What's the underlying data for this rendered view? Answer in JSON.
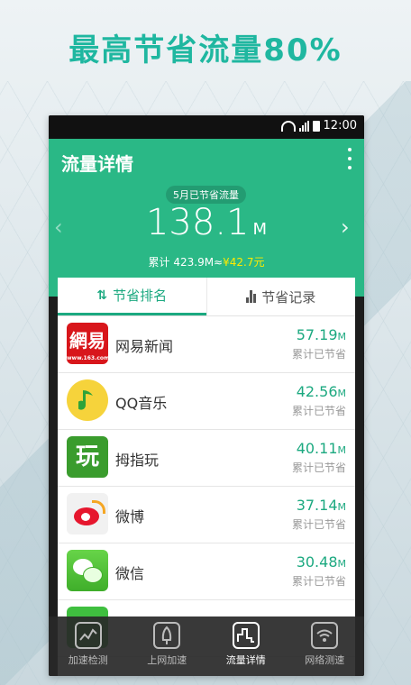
{
  "headline": "最高节省流量80%",
  "status_bar": {
    "time": "12:00"
  },
  "app_bar": {
    "title": "流量详情"
  },
  "summary_card": {
    "month_label": "5月已节省流量",
    "value": "138.1",
    "unit": "M",
    "cumulative": "累计 423.9M≈",
    "money": "¥42.7元"
  },
  "tabs": [
    {
      "label": "节省排名",
      "active": true
    },
    {
      "label": "节省记录",
      "active": false
    }
  ],
  "apps": [
    {
      "name": "网易新闻",
      "amount": "57.19",
      "unit": "M",
      "caption": "累计已节省",
      "icon": "netease-news-icon"
    },
    {
      "name": "QQ音乐",
      "amount": "42.56",
      "unit": "M",
      "caption": "累计已节省",
      "icon": "qq-music-icon"
    },
    {
      "name": "拇指玩",
      "amount": "40.11",
      "unit": "M",
      "caption": "累计已节省",
      "icon": "muzhiwan-icon"
    },
    {
      "name": "微博",
      "amount": "37.14",
      "unit": "M",
      "caption": "累计已节省",
      "icon": "weibo-icon"
    },
    {
      "name": "微信",
      "amount": "30.48",
      "unit": "M",
      "caption": "累计已节省",
      "icon": "wechat-icon"
    }
  ],
  "bottom_nav": [
    {
      "label": "加速检测",
      "icon": "speed-test-icon",
      "active": false
    },
    {
      "label": "上网加速",
      "icon": "rocket-icon",
      "active": false
    },
    {
      "label": "流量详情",
      "icon": "traffic-chart-icon",
      "active": true
    },
    {
      "label": "网络测速",
      "icon": "wifi-icon",
      "active": false
    }
  ],
  "colors": {
    "brand_green": "#2ab886",
    "accent_yellow": "#ffea00",
    "headline": "#1fb7a0"
  }
}
